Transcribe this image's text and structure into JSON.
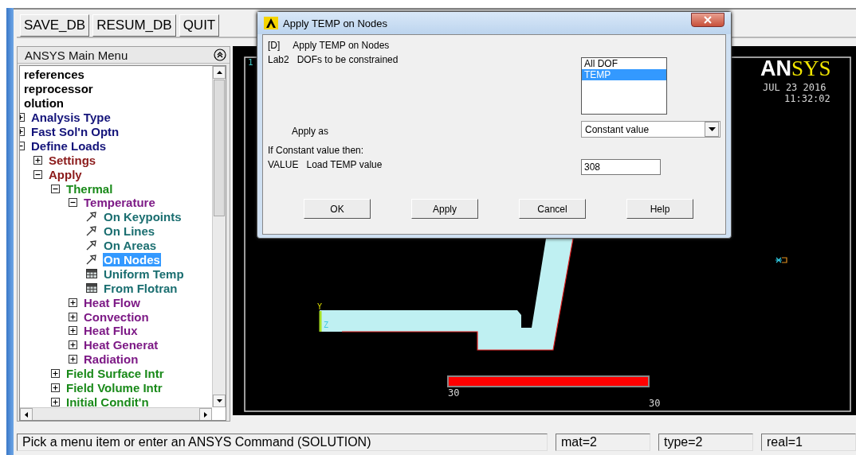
{
  "toolbar": {
    "buttons": [
      "SAVE_DB",
      "RESUM_DB",
      "QUIT"
    ]
  },
  "main_menu": {
    "title": "ANSYS Main Menu",
    "tree": [
      {
        "label": "references",
        "selected": false
      },
      {
        "label": "reprocessor",
        "selected": false
      },
      {
        "label": "olution",
        "selected": false,
        "children": [
          {
            "label": "Analysis Type",
            "kind": "branch",
            "expanded": false,
            "selected": false
          },
          {
            "label": "Fast Sol'n Optn",
            "kind": "branch",
            "expanded": false,
            "selected": false
          },
          {
            "label": "Define Loads",
            "kind": "branch",
            "expanded": true,
            "selected": false,
            "children": [
              {
                "label": "Settings",
                "kind": "branch",
                "expanded": false,
                "selected": false
              },
              {
                "label": "Apply",
                "kind": "branch",
                "expanded": true,
                "selected": false,
                "children": [
                  {
                    "label": "Thermal",
                    "kind": "branch",
                    "expanded": true,
                    "selected": false,
                    "children": [
                      {
                        "label": "Temperature",
                        "kind": "branch",
                        "expanded": true,
                        "selected": false,
                        "children": [
                          {
                            "label": "On Keypoints",
                            "kind": "pick",
                            "selected": false
                          },
                          {
                            "label": "On Lines",
                            "kind": "pick",
                            "selected": false
                          },
                          {
                            "label": "On Areas",
                            "kind": "pick",
                            "selected": false
                          },
                          {
                            "label": "On Nodes",
                            "kind": "pick",
                            "selected": true
                          },
                          {
                            "label": "Uniform Temp",
                            "kind": "form",
                            "selected": false
                          },
                          {
                            "label": "From Flotran",
                            "kind": "form",
                            "selected": false
                          }
                        ]
                      },
                      {
                        "label": "Heat Flow",
                        "kind": "branch",
                        "expanded": false,
                        "selected": false
                      },
                      {
                        "label": "Convection",
                        "kind": "branch",
                        "expanded": false,
                        "selected": false
                      },
                      {
                        "label": "Heat Flux",
                        "kind": "branch",
                        "expanded": false,
                        "selected": false
                      },
                      {
                        "label": "Heat Generat",
                        "kind": "branch",
                        "expanded": false,
                        "selected": false
                      },
                      {
                        "label": "Radiation",
                        "kind": "branch",
                        "expanded": false,
                        "selected": false
                      }
                    ]
                  },
                  {
                    "label": "Field Surface Intr",
                    "kind": "branch",
                    "expanded": false,
                    "selected": false
                  },
                  {
                    "label": "Field Volume Intr",
                    "kind": "branch",
                    "expanded": false,
                    "selected": false
                  },
                  {
                    "label": "Initial Condit'n",
                    "kind": "branch",
                    "expanded": false,
                    "selected": false
                  }
                ]
              }
            ]
          }
        ]
      }
    ]
  },
  "graphics": {
    "window_number": "1",
    "logo": [
      "AN",
      "SYS"
    ],
    "date": "JUL 23 2016",
    "time": "11:32:02",
    "triad": [
      "Y",
      "Z"
    ],
    "legend": {
      "min_label": "30",
      "max_label": "30"
    }
  },
  "dialog": {
    "title": "Apply TEMP on Nodes",
    "heading": {
      "code": "[D]",
      "text": "Apply TEMP on Nodes"
    },
    "dofs": {
      "param": "Lab2",
      "label": "DOFs to be constrained",
      "options": [
        {
          "label": "All DOF",
          "selected": false
        },
        {
          "label": "TEMP",
          "selected": true
        }
      ]
    },
    "apply_as": {
      "label": "Apply as",
      "value": "Constant value"
    },
    "note": "If Constant value then:",
    "value": {
      "param": "VALUE",
      "label": "Load TEMP value",
      "value": "308"
    },
    "buttons": [
      "OK",
      "Apply",
      "Cancel",
      "Help"
    ]
  },
  "status_bar": {
    "prompt": "Pick a menu item or enter an ANSYS Command (SOLUTION)",
    "fields": [
      "mat=2",
      "type=2",
      "real=1"
    ]
  }
}
